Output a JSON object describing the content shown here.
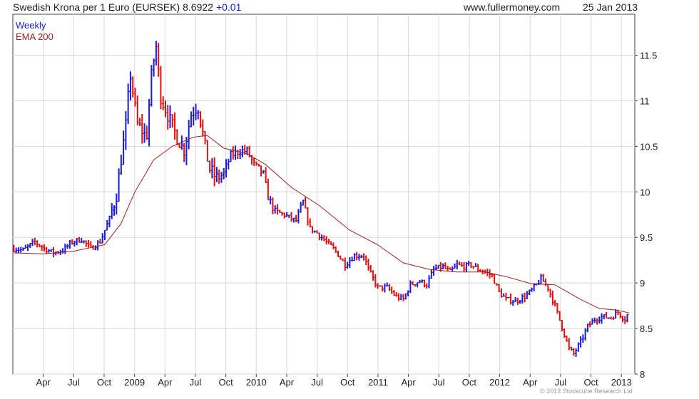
{
  "header": {
    "title": "Swedish Krona per 1 Euro (EURSEK) 8.6922",
    "change": "+0.01",
    "site": "www.fullermoney.com",
    "date": "25 Jan 2013"
  },
  "footer": {
    "copyright": "© 2013 Stockcube Research Ltd"
  },
  "colors": {
    "up": "#1a1ad8",
    "down": "#e01010",
    "ema": "#a02020",
    "grid": "#d8d8d8",
    "axis": "#444444"
  },
  "chart_data": {
    "type": "bar",
    "title": "Swedish Krona per 1 Euro (EURSEK)",
    "timeframe": "Weekly",
    "ylim": [
      8,
      11.95
    ],
    "y_ticks": [
      8,
      8.5,
      9,
      9.5,
      10,
      10.5,
      11,
      11.5
    ],
    "x_ticks": [
      {
        "label": "Apr",
        "t": 2008.25
      },
      {
        "label": "Jul",
        "t": 2008.5
      },
      {
        "label": "Oct",
        "t": 2008.75
      },
      {
        "label": "2009",
        "t": 2009.0
      },
      {
        "label": "Apr",
        "t": 2009.25
      },
      {
        "label": "Jul",
        "t": 2009.5
      },
      {
        "label": "Oct",
        "t": 2009.75
      },
      {
        "label": "2010",
        "t": 2010.0
      },
      {
        "label": "Apr",
        "t": 2010.25
      },
      {
        "label": "Jul",
        "t": 2010.5
      },
      {
        "label": "Oct",
        "t": 2010.75
      },
      {
        "label": "2011",
        "t": 2011.0
      },
      {
        "label": "Apr",
        "t": 2011.25
      },
      {
        "label": "Jul",
        "t": 2011.5
      },
      {
        "label": "Oct",
        "t": 2011.75
      },
      {
        "label": "2012",
        "t": 2012.0
      },
      {
        "label": "Apr",
        "t": 2012.25
      },
      {
        "label": "Jul",
        "t": 2012.5
      },
      {
        "label": "Oct",
        "t": 2012.75
      },
      {
        "label": "2013",
        "t": 2013.0
      }
    ],
    "x_range": [
      2008.0,
      2013.11
    ],
    "series": [
      {
        "name": "Weekly",
        "kind": "ohlc-bars",
        "close_path": [
          [
            "2008-01-04",
            9.38
          ],
          [
            "2008-02-01",
            9.36
          ],
          [
            "2008-03-07",
            9.45
          ],
          [
            "2008-04-04",
            9.38
          ],
          [
            "2008-05-02",
            9.33
          ],
          [
            "2008-05-30",
            9.36
          ],
          [
            "2008-06-27",
            9.45
          ],
          [
            "2008-07-25",
            9.48
          ],
          [
            "2008-08-22",
            9.38
          ],
          [
            "2008-09-19",
            9.45
          ],
          [
            "2008-10-17",
            9.7
          ],
          [
            "2008-11-07",
            9.95
          ],
          [
            "2008-11-21",
            10.35
          ],
          [
            "2008-12-05",
            10.7
          ],
          [
            "2008-12-19",
            11.3
          ],
          [
            "2009-01-09",
            10.75
          ],
          [
            "2009-02-06",
            10.6
          ],
          [
            "2009-02-20",
            11.25
          ],
          [
            "2009-03-06",
            11.62
          ],
          [
            "2009-03-20",
            11.05
          ],
          [
            "2009-04-10",
            10.85
          ],
          [
            "2009-05-08",
            10.6
          ],
          [
            "2009-05-29",
            10.45
          ],
          [
            "2009-06-19",
            10.85
          ],
          [
            "2009-07-10",
            10.95
          ],
          [
            "2009-07-31",
            10.5
          ],
          [
            "2009-08-14",
            10.25
          ],
          [
            "2009-09-04",
            10.15
          ],
          [
            "2009-09-25",
            10.2
          ],
          [
            "2009-10-16",
            10.4
          ],
          [
            "2009-11-13",
            10.45
          ],
          [
            "2009-12-04",
            10.45
          ],
          [
            "2009-12-25",
            10.3
          ],
          [
            "2010-01-22",
            10.2
          ],
          [
            "2010-02-05",
            9.95
          ],
          [
            "2010-02-26",
            9.78
          ],
          [
            "2010-03-26",
            9.75
          ],
          [
            "2010-04-30",
            9.68
          ],
          [
            "2010-05-21",
            9.9
          ],
          [
            "2010-06-11",
            9.6
          ],
          [
            "2010-07-02",
            9.55
          ],
          [
            "2010-07-30",
            9.45
          ],
          [
            "2010-08-27",
            9.35
          ],
          [
            "2010-09-24",
            9.2
          ],
          [
            "2010-10-22",
            9.3
          ],
          [
            "2010-11-19",
            9.3
          ],
          [
            "2010-12-03",
            9.15
          ],
          [
            "2010-12-31",
            8.95
          ],
          [
            "2011-01-28",
            8.95
          ],
          [
            "2011-02-25",
            8.85
          ],
          [
            "2011-03-18",
            8.82
          ],
          [
            "2011-04-08",
            8.98
          ],
          [
            "2011-05-06",
            9.02
          ],
          [
            "2011-05-27",
            8.98
          ],
          [
            "2011-06-17",
            9.15
          ],
          [
            "2011-07-15",
            9.18
          ],
          [
            "2011-08-05",
            9.12
          ],
          [
            "2011-08-26",
            9.2
          ],
          [
            "2011-09-16",
            9.18
          ],
          [
            "2011-10-07",
            9.2
          ],
          [
            "2011-10-28",
            9.15
          ],
          [
            "2011-11-18",
            9.12
          ],
          [
            "2011-12-09",
            9.08
          ],
          [
            "2011-12-30",
            8.9
          ],
          [
            "2012-01-20",
            8.82
          ],
          [
            "2012-02-17",
            8.8
          ],
          [
            "2012-03-16",
            8.85
          ],
          [
            "2012-04-06",
            8.92
          ],
          [
            "2012-04-20",
            8.98
          ],
          [
            "2012-05-04",
            9.05
          ],
          [
            "2012-05-25",
            8.95
          ],
          [
            "2012-06-15",
            8.75
          ],
          [
            "2012-07-06",
            8.52
          ],
          [
            "2012-07-27",
            8.28
          ],
          [
            "2012-08-10",
            8.22
          ],
          [
            "2012-08-31",
            8.35
          ],
          [
            "2012-09-21",
            8.52
          ],
          [
            "2012-10-12",
            8.6
          ],
          [
            "2012-11-02",
            8.63
          ],
          [
            "2012-11-30",
            8.62
          ],
          [
            "2012-12-21",
            8.68
          ],
          [
            "2013-01-11",
            8.6
          ],
          [
            "2013-01-25",
            8.69
          ]
        ]
      },
      {
        "name": "EMA 200",
        "kind": "line",
        "points": [
          [
            "2008-01-04",
            9.33
          ],
          [
            "2008-04-04",
            9.32
          ],
          [
            "2008-07-04",
            9.35
          ],
          [
            "2008-10-03",
            9.42
          ],
          [
            "2008-11-21",
            9.65
          ],
          [
            "2009-01-02",
            10.0
          ],
          [
            "2009-02-27",
            10.35
          ],
          [
            "2009-04-24",
            10.5
          ],
          [
            "2009-06-26",
            10.6
          ],
          [
            "2009-08-07",
            10.62
          ],
          [
            "2009-09-25",
            10.48
          ],
          [
            "2009-12-04",
            10.42
          ],
          [
            "2010-01-29",
            10.3
          ],
          [
            "2010-04-16",
            10.05
          ],
          [
            "2010-07-09",
            9.85
          ],
          [
            "2010-10-08",
            9.58
          ],
          [
            "2010-12-31",
            9.42
          ],
          [
            "2011-03-18",
            9.22
          ],
          [
            "2011-06-03",
            9.15
          ],
          [
            "2011-08-26",
            9.12
          ],
          [
            "2011-11-18",
            9.12
          ],
          [
            "2012-01-20",
            9.07
          ],
          [
            "2012-04-06",
            8.99
          ],
          [
            "2012-06-15",
            8.98
          ],
          [
            "2012-08-31",
            8.82
          ],
          [
            "2012-10-26",
            8.72
          ],
          [
            "2012-12-21",
            8.7
          ],
          [
            "2013-01-25",
            8.67
          ]
        ]
      }
    ]
  }
}
